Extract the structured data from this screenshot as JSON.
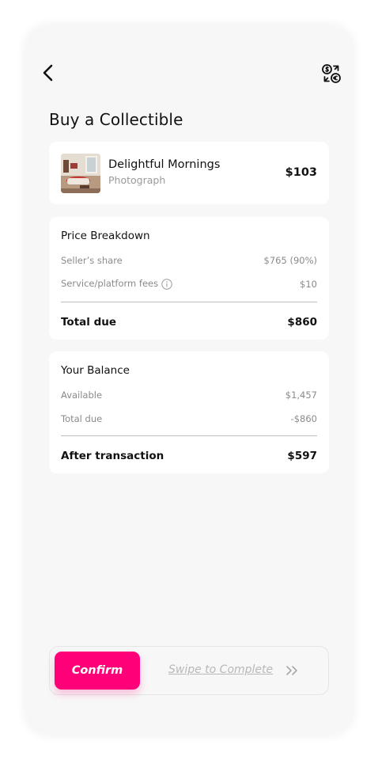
{
  "page": {
    "title": "Buy a Collectible"
  },
  "header": {
    "back_icon": "chevron-left-icon",
    "currency_icon": "currency-exchange-icon"
  },
  "item": {
    "name": "Delightful Mornings",
    "type": "Photograph",
    "price": "$103",
    "thumbnail": "living-room-photo"
  },
  "price_breakdown": {
    "heading": "Price Breakdown",
    "rows": [
      {
        "label": "Seller’s share",
        "value": "$765 (90%)"
      },
      {
        "label": "Service/platform fees",
        "value": "$10",
        "icon": "info-icon"
      }
    ],
    "total_label": "Total due",
    "total_value": "$860"
  },
  "balance": {
    "heading": "Your Balance",
    "rows": [
      {
        "label": "Available",
        "value": "$1,457"
      },
      {
        "label": "Total due",
        "value": "-$860"
      }
    ],
    "total_label": "After transaction",
    "total_value": "$597"
  },
  "action": {
    "confirm_label": "Confirm",
    "swipe_hint": "Swipe to Complete",
    "swipe_icon": "double-chevron-right-icon"
  },
  "colors": {
    "accent": "#ff0078",
    "background": "#f7f7f7",
    "card": "#ffffff",
    "muted_text": "#8a8a8a"
  }
}
